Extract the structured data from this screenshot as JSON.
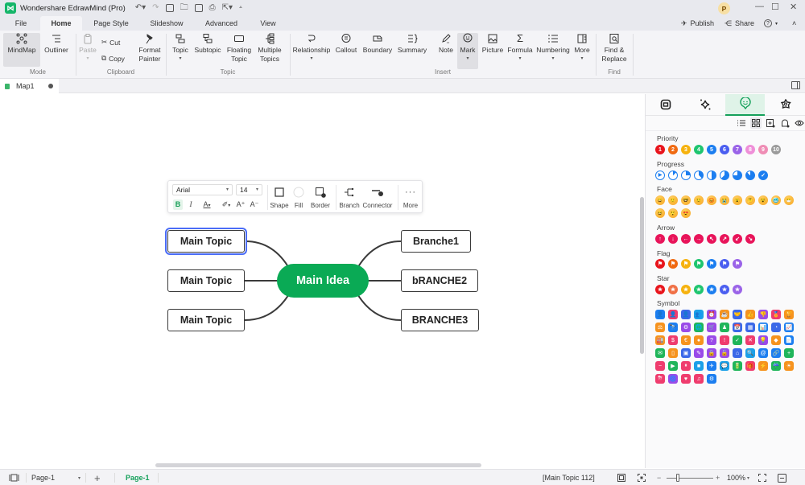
{
  "app": {
    "title": "Wondershare EdrawMind (Pro)",
    "avatar_letter": "P",
    "publish_label": "Publish",
    "share_label": "Share",
    "help_label": "?"
  },
  "menu_tabs": [
    "File",
    "Home",
    "Page Style",
    "Slideshow",
    "Advanced",
    "View"
  ],
  "active_tab": "Home",
  "ribbon": {
    "mode": {
      "label": "Mode",
      "mindmap": "MindMap",
      "outliner": "Outliner"
    },
    "clipboard": {
      "label": "Clipboard",
      "paste": "Paste",
      "cut": "Cut",
      "copy": "Copy",
      "format_painter_1": "Format",
      "format_painter_2": "Painter"
    },
    "topic": {
      "label": "Topic",
      "topic": "Topic",
      "subtopic": "Subtopic",
      "floating_1": "Floating",
      "floating_2": "Topic",
      "multiple_1": "Multiple",
      "multiple_2": "Topics"
    },
    "insert": {
      "label": "Insert",
      "relationship": "Relationship",
      "callout": "Callout",
      "boundary": "Boundary",
      "summary": "Summary",
      "note": "Note",
      "mark": "Mark",
      "picture": "Picture",
      "formula": "Formula",
      "numbering": "Numbering",
      "more": "More"
    },
    "find": {
      "label": "Find",
      "find_1": "Find &",
      "find_2": "Replace"
    }
  },
  "document": {
    "tab_name": "Map1"
  },
  "floating_toolbar": {
    "font": "Arial",
    "size": "14",
    "bold": "B",
    "italic": "I",
    "font_color": "A",
    "grow": "A⁺",
    "shrink": "A⁻",
    "shape": "Shape",
    "fill": "Fill",
    "border": "Border",
    "branch": "Branch",
    "connector": "Connector",
    "more": "More"
  },
  "mindmap": {
    "central": "Main Idea",
    "left_topics": [
      "Main Topic",
      "Main Topic",
      "Main Topic"
    ],
    "right_topics": [
      "Branche1",
      "bRANCHE2",
      "BRANCHE3"
    ],
    "selected": "left-0",
    "accent_color": "#0aaa55",
    "selection_color": "#4a6cf7"
  },
  "right_panel": {
    "active_tab": "mark",
    "sections": {
      "priority": "Priority",
      "progress": "Progress",
      "face": "Face",
      "arrow": "Arrow",
      "flag": "Flag",
      "star": "Star",
      "symbol": "Symbol"
    },
    "priority": [
      {
        "n": "1",
        "c": "#e8141c"
      },
      {
        "n": "2",
        "c": "#f06a12"
      },
      {
        "n": "3",
        "c": "#f6b20e"
      },
      {
        "n": "4",
        "c": "#1fc56f"
      },
      {
        "n": "5",
        "c": "#1c7ef0"
      },
      {
        "n": "6",
        "c": "#4a5ef0"
      },
      {
        "n": "7",
        "c": "#9a63e8"
      },
      {
        "n": "8",
        "c": "#ef8fd8"
      },
      {
        "n": "9",
        "c": "#ef8db5"
      },
      {
        "n": "10",
        "c": "#9b9b9b"
      }
    ],
    "progress": [
      "0%",
      "12.5%",
      "25%",
      "37.5%",
      "50%",
      "62.5%",
      "75%",
      "87.5%",
      "100%"
    ],
    "progress_color": "#1c7ef0",
    "faces": [
      "😄",
      "🙂",
      "🤓",
      "😟",
      "😡",
      "😭",
      "😮",
      "🤔",
      "😵",
      "🥶",
      "😷",
      "😆",
      "😲",
      "😍"
    ],
    "arrows": [
      "↑",
      "↓",
      "←",
      "→",
      "↖",
      "↗",
      "↙",
      "↘"
    ],
    "arrow_color": "#e8145a",
    "flag_colors": [
      "#e8141c",
      "#f06a12",
      "#f6b20e",
      "#1fc56f",
      "#1c7ef0",
      "#4a5ef0",
      "#9a63e8"
    ],
    "star_colors": [
      "#e8141c",
      "#f07046",
      "#f6b20e",
      "#1fc56f",
      "#1c7ef0",
      "#4a5ef0",
      "#9a63e8"
    ],
    "symbols": [
      {
        "g": "👤",
        "c": "#1c7ef0"
      },
      {
        "g": "👤",
        "c": "#ef3c6e"
      },
      {
        "g": "👤",
        "c": "#3b68e8"
      },
      {
        "g": "👥",
        "c": "#1ca0e8"
      },
      {
        "g": "⏰",
        "c": "#9a4be8"
      },
      {
        "g": "☕",
        "c": "#f6931e"
      },
      {
        "g": "🤝",
        "c": "#3b68e8"
      },
      {
        "g": "👍",
        "c": "#f6931e"
      },
      {
        "g": "👎",
        "c": "#9a4be8"
      },
      {
        "g": "🏅",
        "c": "#ef3c6e"
      },
      {
        "g": "🏆",
        "c": "#f6931e"
      },
      {
        "g": "⚖",
        "c": "#f6931e"
      },
      {
        "g": "🔭",
        "c": "#1c7ef0"
      },
      {
        "g": "⚙",
        "c": "#9a4be8"
      },
      {
        "g": "🌐",
        "c": "#1fb55a"
      },
      {
        "g": "🛒",
        "c": "#9a4be8"
      },
      {
        "g": "♟",
        "c": "#1fb55a"
      },
      {
        "g": "📅",
        "c": "#3b68e8"
      },
      {
        "g": "▦",
        "c": "#3b68e8"
      },
      {
        "g": "📊",
        "c": "#1c7ef0"
      },
      {
        "g": "◔",
        "c": "#3b68e8"
      },
      {
        "g": "📈",
        "c": "#1c7ef0"
      },
      {
        "g": "🏭",
        "c": "#f6931e"
      },
      {
        "g": "$",
        "c": "#ef3c6e"
      },
      {
        "g": "€",
        "c": "#f6931e"
      },
      {
        "g": "●",
        "c": "#f6931e"
      },
      {
        "g": "?",
        "c": "#9a4be8"
      },
      {
        "g": "!",
        "c": "#ef3c6e"
      },
      {
        "g": "✓",
        "c": "#1fb55a"
      },
      {
        "g": "✕",
        "c": "#ef3c6e"
      },
      {
        "g": "💡",
        "c": "#9a4be8"
      },
      {
        "g": "◆",
        "c": "#f6931e"
      },
      {
        "g": "📄",
        "c": "#1c7ef0"
      },
      {
        "g": "✉",
        "c": "#1fb55a"
      },
      {
        "g": "▯",
        "c": "#f6931e"
      },
      {
        "g": "▣",
        "c": "#3b68e8"
      },
      {
        "g": "✎",
        "c": "#9a4be8"
      },
      {
        "g": "🔒",
        "c": "#9a4be8"
      },
      {
        "g": "🔓",
        "c": "#9a4be8"
      },
      {
        "g": "⌂",
        "c": "#3b68e8"
      },
      {
        "g": "🔍",
        "c": "#1ca0e8"
      },
      {
        "g": "@",
        "c": "#1c7ef0"
      },
      {
        "g": "🔗",
        "c": "#1c7ef0"
      },
      {
        "g": "+",
        "c": "#1fb55a"
      },
      {
        "g": "−",
        "c": "#ef3c6e"
      },
      {
        "g": "▶",
        "c": "#1fb55a"
      },
      {
        "g": "⏸",
        "c": "#ef3c6e"
      },
      {
        "g": "■",
        "c": "#1ca0e8"
      },
      {
        "g": "✈",
        "c": "#1c7ef0"
      },
      {
        "g": "💬",
        "c": "#1ca0e8"
      },
      {
        "g": "🔋",
        "c": "#1fb55a"
      },
      {
        "g": "🎁",
        "c": "#ef3c6e"
      },
      {
        "g": "⚡",
        "c": "#f6931e"
      },
      {
        "g": "☔",
        "c": "#1fb55a"
      },
      {
        "g": "☀",
        "c": "#f6931e"
      },
      {
        "g": "⛈",
        "c": "#ef3c6e"
      },
      {
        "g": "🌀",
        "c": "#9a4be8"
      },
      {
        "g": "♥",
        "c": "#ef3c6e"
      },
      {
        "g": "♫",
        "c": "#ef3c6e"
      },
      {
        "g": "⚙",
        "c": "#1c7ef0"
      }
    ]
  },
  "status": {
    "page_select": "Page-1",
    "active_page": "Page-1",
    "selection": "[Main Topic 112]",
    "zoom": "100%",
    "zoom_level": 0.5
  }
}
